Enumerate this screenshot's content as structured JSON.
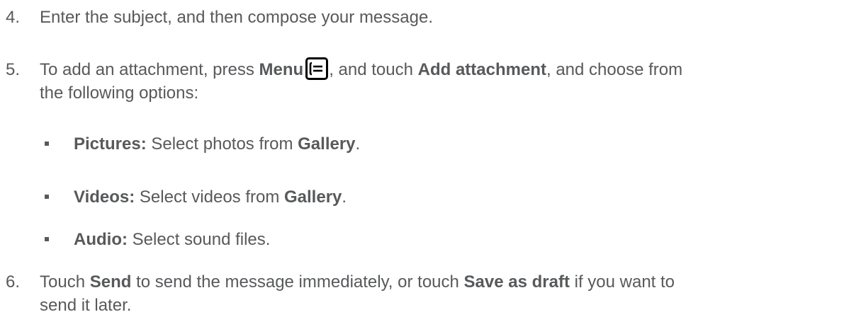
{
  "step4": {
    "number": "4.",
    "text": "Enter the subject, and then compose your message."
  },
  "step5": {
    "number": "5.",
    "t1": "To add an attachment, press ",
    "menu": "Menu",
    "icon": "menu-key-icon",
    "t2": ", and touch ",
    "add_attachment": "Add attachment",
    "t3": ", and choose from",
    "line2": "the following options:"
  },
  "options": [
    {
      "label": "Pictures:",
      "text": " Select photos from ",
      "target": "Gallery",
      "end": "."
    },
    {
      "label": "Videos:",
      "text": " Select videos from ",
      "target": "Gallery",
      "end": "."
    },
    {
      "label": "Audio:",
      "text": " Select sound files."
    }
  ],
  "step6": {
    "number": "6.",
    "t1": "Touch ",
    "send": "Send",
    "t2": " to send the message immediately, or touch ",
    "save_draft": "Save as draft",
    "t3": " if you want to",
    "line2": "send it later."
  }
}
